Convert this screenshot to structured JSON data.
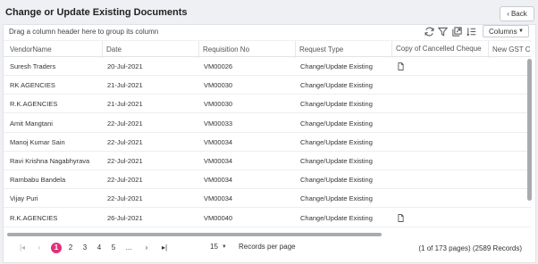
{
  "page": {
    "title": "Change or Update Existing Documents",
    "back_label": "Back"
  },
  "toolbar": {
    "drag_hint": "Drag a column header here to group its column",
    "columns_label": "Columns"
  },
  "columns": [
    "VendorName",
    "Date",
    "Requisition No",
    "Request Type",
    "Copy of Cancelled Cheque",
    "New GST C"
  ],
  "rows": [
    {
      "vendor": "Suresh Traders",
      "date": "20-Jul-2021",
      "req_no": "VM00026",
      "type": "Change/Update Existing",
      "cheque_icon": "document-icon"
    },
    {
      "vendor": "RK AGENCIES",
      "date": "21-Jul-2021",
      "req_no": "VM00030",
      "type": "Change/Update Existing",
      "cheque_icon": ""
    },
    {
      "vendor": "R.K.AGENCIES",
      "date": "21-Jul-2021",
      "req_no": "VM00030",
      "type": "Change/Update Existing",
      "cheque_icon": ""
    },
    {
      "vendor": "Amit Mangtani",
      "date": "22-Jul-2021",
      "req_no": "VM00033",
      "type": "Change/Update Existing",
      "cheque_icon": ""
    },
    {
      "vendor": "Manoj Kumar Sain",
      "date": "22-Jul-2021",
      "req_no": "VM00034",
      "type": "Change/Update Existing",
      "cheque_icon": ""
    },
    {
      "vendor": "Ravi Krishna Nagabhyrava",
      "date": "22-Jul-2021",
      "req_no": "VM00034",
      "type": "Change/Update Existing",
      "cheque_icon": ""
    },
    {
      "vendor": "Rambabu Bandela",
      "date": "22-Jul-2021",
      "req_no": "VM00034",
      "type": "Change/Update Existing",
      "cheque_icon": ""
    },
    {
      "vendor": "Vijay Puri",
      "date": "22-Jul-2021",
      "req_no": "VM00034",
      "type": "Change/Update Existing",
      "cheque_icon": ""
    },
    {
      "vendor": "R.K.AGENCIES",
      "date": "26-Jul-2021",
      "req_no": "VM00040",
      "type": "Change/Update Existing",
      "cheque_icon": "document-icon"
    }
  ],
  "pager": {
    "pages": [
      "1",
      "2",
      "3",
      "4",
      "5",
      "..."
    ],
    "active_page": "1",
    "page_size": "15",
    "records_label": "Records per page",
    "summary": "(1 of 173 pages) (2589 Records)"
  },
  "colors": {
    "accent": "#e0307a",
    "scrollbar": "#a8abb0"
  }
}
